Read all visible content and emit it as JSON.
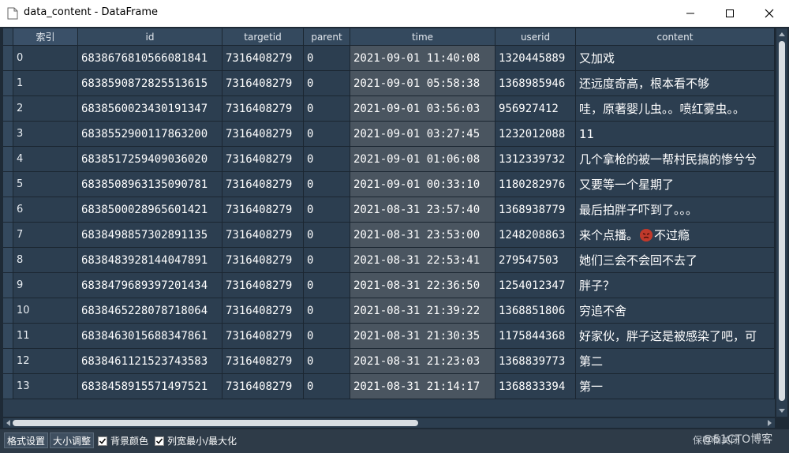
{
  "window": {
    "title": "data_content - DataFrame"
  },
  "table": {
    "index_header": "索引",
    "columns": [
      "id",
      "targetid",
      "parent",
      "time",
      "userid",
      "content"
    ],
    "rows": [
      {
        "index": "0",
        "id": "6838676810566081841",
        "targetid": "7316408279",
        "parent": "0",
        "time": "2021-09-01 11:40:08",
        "userid": "1320445889",
        "content": "又加戏"
      },
      {
        "index": "1",
        "id": "6838590872825513615",
        "targetid": "7316408279",
        "parent": "0",
        "time": "2021-09-01 05:58:38",
        "userid": "1368985946",
        "content": "还远度奇高，根本看不够"
      },
      {
        "index": "2",
        "id": "6838560023430191347",
        "targetid": "7316408279",
        "parent": "0",
        "time": "2021-09-01 03:56:03",
        "userid": "956927412",
        "content": "哇，原著婴儿虫。。喷红雾虫。。"
      },
      {
        "index": "3",
        "id": "6838552900117863200",
        "targetid": "7316408279",
        "parent": "0",
        "time": "2021-09-01 03:27:45",
        "userid": "1232012088",
        "content": "11"
      },
      {
        "index": "4",
        "id": "6838517259409036020",
        "targetid": "7316408279",
        "parent": "0",
        "time": "2021-09-01 01:06:08",
        "userid": "1312339732",
        "content": "几个拿枪的被一帮村民搞的惨兮兮"
      },
      {
        "index": "5",
        "id": "6838508963135090781",
        "targetid": "7316408279",
        "parent": "0",
        "time": "2021-09-01 00:33:10",
        "userid": "1180282976",
        "content": "又要等一个星期了"
      },
      {
        "index": "6",
        "id": "6838500028965601421",
        "targetid": "7316408279",
        "parent": "0",
        "time": "2021-08-31 23:57:40",
        "userid": "1368938779",
        "content": "最后拍胖子吓到了。。。"
      },
      {
        "index": "7",
        "id": "6838498857302891135",
        "targetid": "7316408279",
        "parent": "0",
        "time": "2021-08-31 23:53:00",
        "userid": "1248208863",
        "content_pre": "来个点播。",
        "content_post": "不过瘾",
        "emoji": "angry-face-icon"
      },
      {
        "index": "8",
        "id": "6838483928144047891",
        "targetid": "7316408279",
        "parent": "0",
        "time": "2021-08-31 22:53:41",
        "userid": "279547503",
        "content": "她们三会不会回不去了"
      },
      {
        "index": "9",
        "id": "6838479689397201434",
        "targetid": "7316408279",
        "parent": "0",
        "time": "2021-08-31 22:36:50",
        "userid": "1254012347",
        "content": "胖子？"
      },
      {
        "index": "10",
        "id": "6838465228078718064",
        "targetid": "7316408279",
        "parent": "0",
        "time": "2021-08-31 21:39:22",
        "userid": "1368851806",
        "content": "穷追不舍"
      },
      {
        "index": "11",
        "id": "6838463015688347861",
        "targetid": "7316408279",
        "parent": "0",
        "time": "2021-08-31 21:30:35",
        "userid": "1175844368",
        "content": "好家伙，胖子这是被感染了吧，可"
      },
      {
        "index": "12",
        "id": "6838461121523743583",
        "targetid": "7316408279",
        "parent": "0",
        "time": "2021-08-31 21:23:03",
        "userid": "1368839773",
        "content": "第二"
      },
      {
        "index": "13",
        "id": "6838458915571497521",
        "targetid": "7316408279",
        "parent": "0",
        "time": "2021-08-31 21:14:17",
        "userid": "1368833394",
        "content": "第一"
      }
    ]
  },
  "statusbar": {
    "format_btn": "格式设置",
    "resize_btn": "大小调整",
    "bg_color": "背景颜色",
    "col_width": "列宽最小/最大化",
    "right_text": "保存和关闭"
  },
  "watermark": "@51CTO博客",
  "colors": {
    "cell_bg": "#2c3e50",
    "time_bg": "#4a5560",
    "header_bg": "#34495e",
    "grid_line": "#1b2631"
  }
}
